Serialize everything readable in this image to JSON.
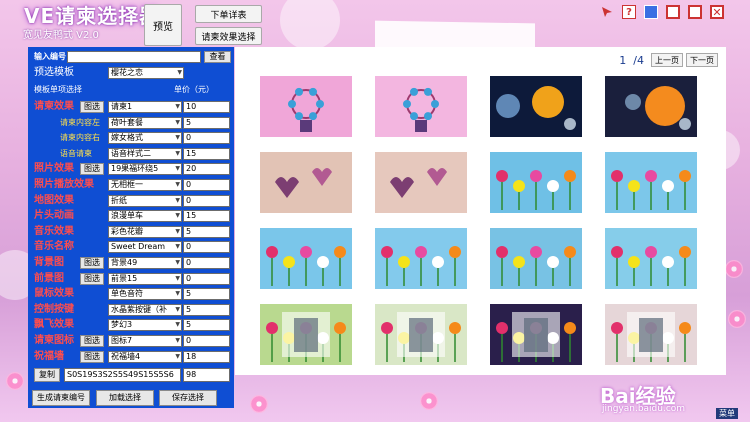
{
  "header": {
    "title": "VE请柬选择器",
    "subtitle": "宽见友鸭式 V2.0",
    "preview_btn": "预览",
    "order_details_btn": "下单详表",
    "effect_select_btn": "请柬效果选择"
  },
  "window_controls": [
    "cursor-icon",
    "help-icon",
    "blue-square-icon",
    "minimize-icon",
    "restore-icon",
    "close-icon"
  ],
  "panel": {
    "input_label": "输入编号",
    "input_value": "",
    "search_btn": "查看",
    "preset_label": "预选模板",
    "preset_value": "樱花之恋",
    "module_label": "模板单项选择",
    "price_label": "单价（元）",
    "rows": [
      {
        "label": "请柬效果",
        "kind": "main",
        "btn": "图选",
        "value": "请柬1",
        "price": "10"
      },
      {
        "label": "请柬内容左",
        "kind": "sub",
        "btn": "",
        "value": "荷叶套餐",
        "price": "5"
      },
      {
        "label": "请柬内容右",
        "kind": "sub",
        "btn": "",
        "value": "嫁女格式",
        "price": "0"
      },
      {
        "label": "语音请柬",
        "kind": "sub",
        "btn": "",
        "value": "语音样式二",
        "price": "15"
      },
      {
        "label": "照片效果",
        "kind": "main",
        "btn": "图选",
        "value": "19果福环绕5",
        "price": "20"
      },
      {
        "label": "照片播放效果",
        "kind": "main",
        "btn": "",
        "value": "无相框一",
        "price": "0"
      },
      {
        "label": "地图效果",
        "kind": "main",
        "btn": "",
        "value": "折纸",
        "price": "0"
      },
      {
        "label": "片头动画",
        "kind": "main",
        "btn": "",
        "value": "浪漫单车",
        "price": "15"
      },
      {
        "label": "音乐效果",
        "kind": "main",
        "btn": "",
        "value": "彩色花瓣",
        "price": "5"
      },
      {
        "label": "音乐名称",
        "kind": "main",
        "btn": "",
        "value": "Sweet Dream",
        "price": "0"
      },
      {
        "label": "背景图",
        "kind": "main",
        "btn": "图选",
        "value": "背景49",
        "price": "0"
      },
      {
        "label": "前景图",
        "kind": "main",
        "btn": "图选",
        "value": "前景15",
        "price": "0"
      },
      {
        "label": "鼠标效果",
        "kind": "main",
        "btn": "",
        "value": "单色音符",
        "price": "5"
      },
      {
        "label": "控制按键",
        "kind": "main",
        "btn": "",
        "value": "水晶紫按键（补",
        "price": "5"
      },
      {
        "label": "飘飞效果",
        "kind": "main",
        "btn": "",
        "value": "梦幻3",
        "price": "5"
      },
      {
        "label": "请柬图标",
        "kind": "main",
        "btn": "图选",
        "value": "图标7",
        "price": "0"
      },
      {
        "label": "祝福墙",
        "kind": "main",
        "btn": "图选",
        "value": "祝福墙4",
        "price": "18"
      }
    ],
    "copy_btn": "复制",
    "code_value": "S0S19S3S2S5S49S15S5S6",
    "total_value": "98",
    "gen_btn": "生成请柬编号",
    "load_btn": "加载选择",
    "save_btn": "保存选择"
  },
  "pager": {
    "current": "1",
    "total": "/4",
    "prev": "上一页",
    "next": "下一页"
  },
  "thumbnails": [
    {
      "name": "thumb-pink-carousel-1",
      "color": "#f0a6d8"
    },
    {
      "name": "thumb-pink-carousel-2",
      "color": "#f3b6e0"
    },
    {
      "name": "thumb-planets-1",
      "color": "#0d1a3a"
    },
    {
      "name": "thumb-planets-2",
      "color": "#1a1f3c"
    },
    {
      "name": "thumb-hearts-1",
      "color": "#e2c3b5"
    },
    {
      "name": "thumb-hearts-2",
      "color": "#e6c8bd"
    },
    {
      "name": "thumb-pinwheels-1",
      "color": "#6fc0e6"
    },
    {
      "name": "thumb-pinwheels-2",
      "color": "#7cc7ea"
    },
    {
      "name": "thumb-flowers-1",
      "color": "#7ac6ea"
    },
    {
      "name": "thumb-flowers-2",
      "color": "#83caec"
    },
    {
      "name": "thumb-flowers-3",
      "color": "#78c2e4"
    },
    {
      "name": "thumb-flowers-4",
      "color": "#86cdea"
    },
    {
      "name": "thumb-photo-frame-1",
      "color": "#b9d98f"
    },
    {
      "name": "thumb-photo-frame-2",
      "color": "#d9e7c6"
    },
    {
      "name": "thumb-photo-dark-3d",
      "color": "#2a1f4b"
    },
    {
      "name": "thumb-photo-collage",
      "color": "#e6d6d8"
    }
  ],
  "brand": {
    "text": "Bai经验",
    "sub": "jingyan.baidu.com",
    "corner": "菜单"
  }
}
